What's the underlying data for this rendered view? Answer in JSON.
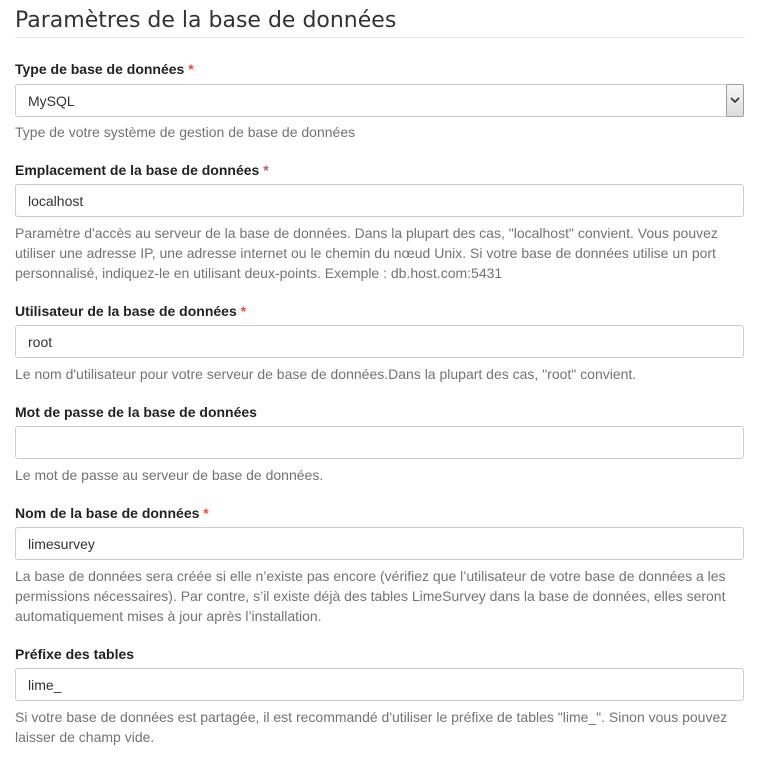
{
  "page_title": "Paramètres de la base de données",
  "required_marker": "*",
  "fields": [
    {
      "label": "Type de base de données",
      "required": true,
      "value": "MySQL",
      "help": "Type de votre système de gestion de base de données"
    },
    {
      "label": "Emplacement de la base de données",
      "required": true,
      "value": "localhost",
      "help": "Paramètre d'accès au serveur de la base de données. Dans la plupart des cas, \"localhost\" convient. Vous pouvez utiliser une adresse IP, une adresse internet ou le chemin du nœud Unix. Si votre base de données utilise un port personnalisé, indiquez-le en utilisant deux-points. Exemple : db.host.com:5431"
    },
    {
      "label": "Utilisateur de la base de données",
      "required": true,
      "value": "root",
      "help": "Le nom d'utilisateur pour votre serveur de base de données.Dans la plupart des cas, \"root\" convient."
    },
    {
      "label": "Mot de passe de la base de données",
      "required": false,
      "value": "",
      "help": "Le mot de passe au serveur de base de données."
    },
    {
      "label": "Nom de la base de données",
      "required": true,
      "value": "limesurvey",
      "help": "La base de données sera créée si elle n’existe pas encore (vérifiez que l’utilisateur de votre base de données a les permissions nécessaires). Par contre, s’il existe déjà des tables LimeSurvey dans la base de données, elles seront automatiquement mises à jour après l’installation."
    },
    {
      "label": "Préfixe des tables",
      "required": false,
      "value": "lime_",
      "help": "Si votre base de données est partagée, il est recommandé d'utiliser le préfixe de tables \"lime_\". Sinon vous pouvez laisser de champ vide."
    }
  ],
  "icons": {
    "select_arrow": "chevron-down-icon"
  },
  "colors": {
    "required": "#d9534f",
    "help_text": "#737373",
    "border": "#cccccc"
  }
}
